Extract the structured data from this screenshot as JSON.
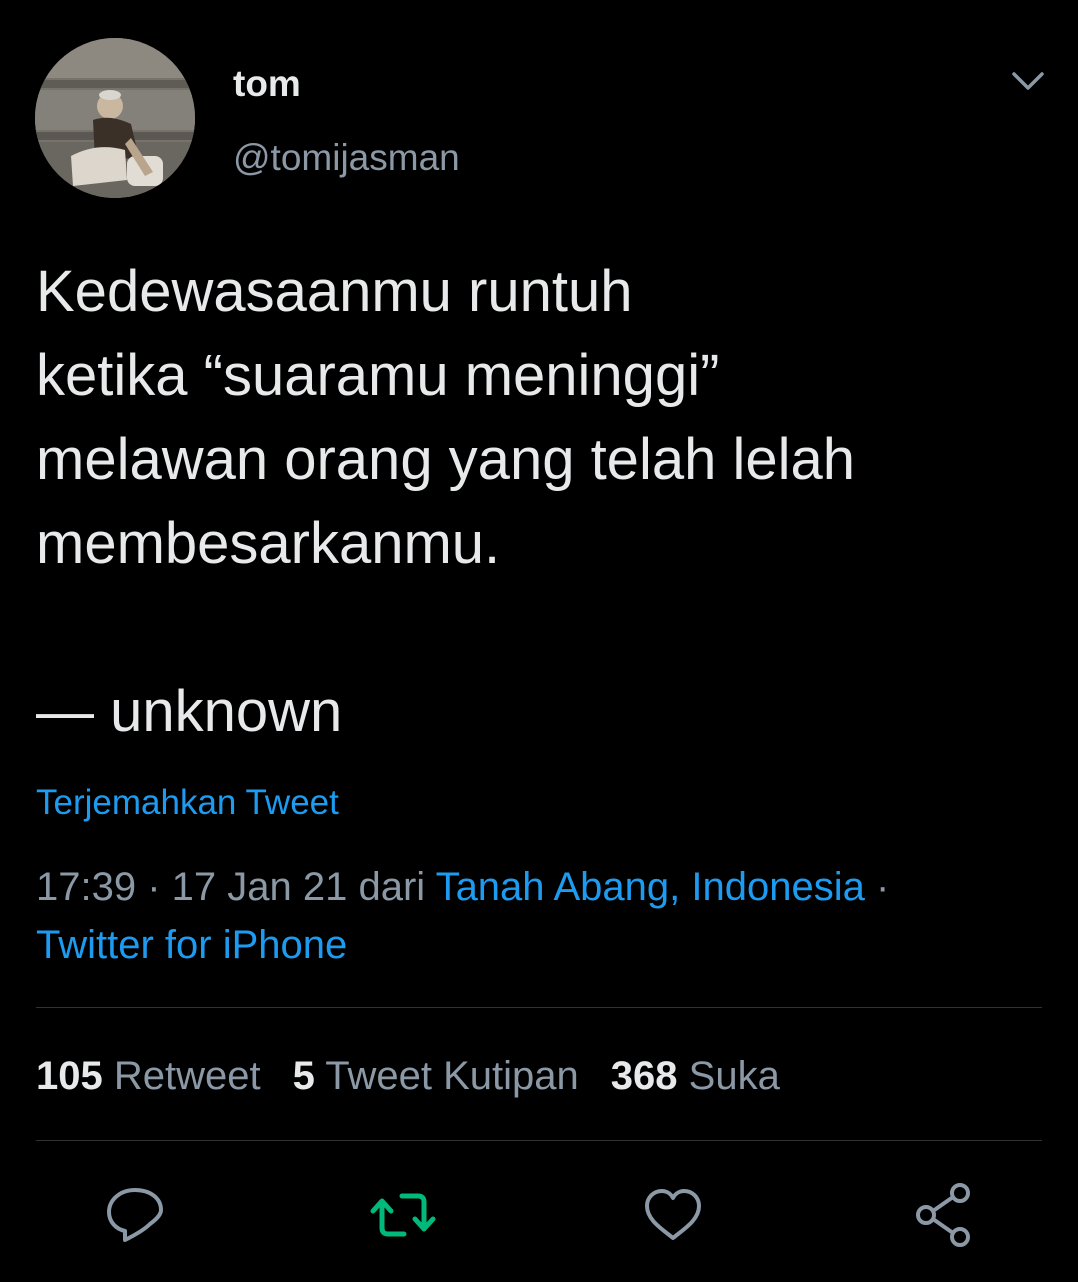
{
  "tweet": {
    "author": {
      "display_name": "tom",
      "handle": "@tomijasman"
    },
    "text": "Kedewasaanmu runtuh\nketika “suaramu meninggi”\nmelawan orang yang telah lelah\nmembesarkanmu.\n\n— unknown",
    "translate_label": "Terjemahkan Tweet",
    "meta": {
      "time": "17:39",
      "separator": " · ",
      "date": "17 Jan 21",
      "from_label": " dari ",
      "location": "Tanah Abang, Indonesia",
      "trailing_separator": " ·",
      "source": "Twitter for iPhone"
    },
    "stats": {
      "retweets_count": "105",
      "retweets_label": "Retweet",
      "quotes_count": "5",
      "quotes_label": "Tweet Kutipan",
      "likes_count": "368",
      "likes_label": "Suka"
    }
  },
  "icons": {
    "more": "chevron-down-icon",
    "reply": "reply-icon",
    "retweet": "retweet-icon",
    "like": "heart-icon",
    "share": "share-icon"
  },
  "colors": {
    "background": "#000000",
    "text_primary": "#e7e9ea",
    "text_secondary": "#8b98a5",
    "link": "#1d9bf0",
    "retweet_active": "#00ba7c",
    "divider": "#2f3336"
  }
}
